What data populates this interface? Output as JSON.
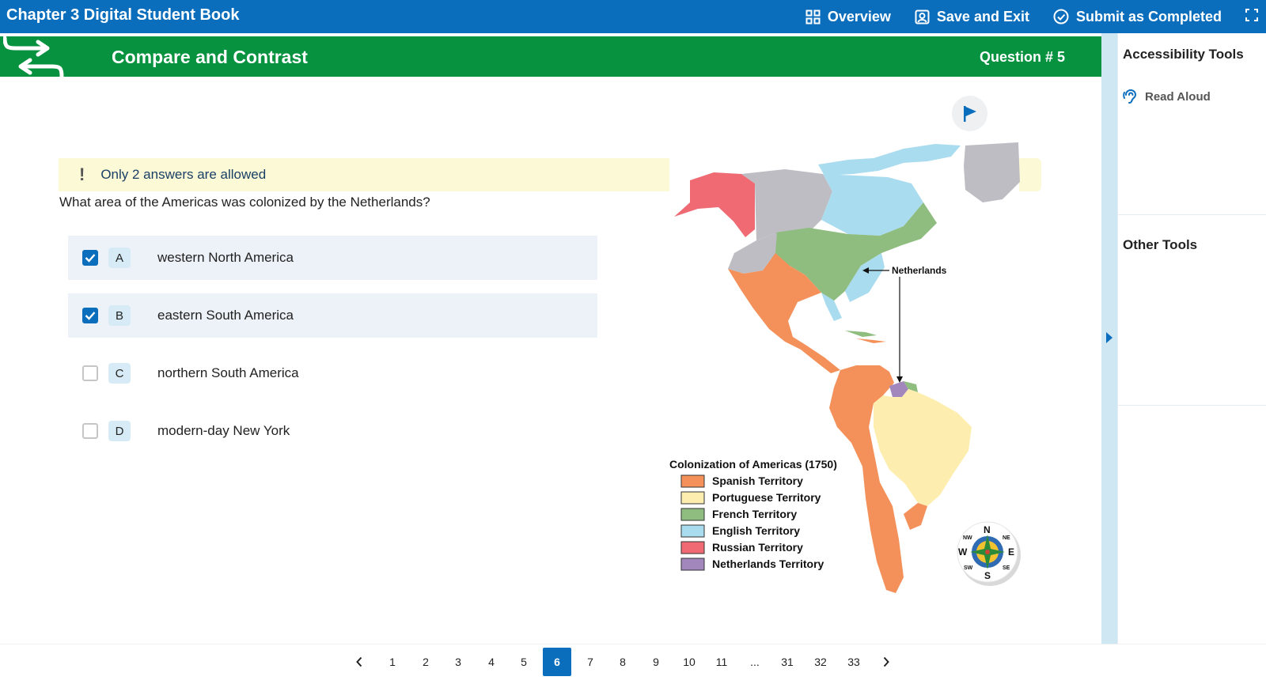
{
  "app": {
    "title": "Chapter 3 Digital Student Book",
    "actions": {
      "overview": "Overview",
      "save_exit": "Save and Exit",
      "submit": "Submit as Completed"
    }
  },
  "header": {
    "title": "Compare and Contrast",
    "question_number": "Question # 5"
  },
  "notice": {
    "icon": "!",
    "text": "Only 2 answers are allowed"
  },
  "question": {
    "text": "What area of the Americas was colonized by the Netherlands?",
    "options": [
      {
        "letter": "A",
        "text": "western North America",
        "checked": true
      },
      {
        "letter": "B",
        "text": "eastern South America",
        "checked": true
      },
      {
        "letter": "C",
        "text": "northern South America",
        "checked": false
      },
      {
        "letter": "D",
        "text": "modern-day New York",
        "checked": false
      }
    ]
  },
  "map": {
    "callout": "Netherlands",
    "legend_title": "Colonization of Americas (1750)",
    "legend": [
      {
        "label": "Spanish Territory",
        "color": "#f4915a"
      },
      {
        "label": "Portuguese Territory",
        "color": "#fdeeb0"
      },
      {
        "label": "French Territory",
        "color": "#8fbd80"
      },
      {
        "label": "English Territory",
        "color": "#a9dcee"
      },
      {
        "label": "Russian Territory",
        "color": "#ef6a73"
      },
      {
        "label": "Netherlands Territory",
        "color": "#a287bd"
      }
    ],
    "unclaimed_color": "#bdbdc3",
    "compass": {
      "n": "N",
      "s": "S",
      "e": "E",
      "w": "W",
      "ne": "NE",
      "nw": "NW",
      "se": "SE",
      "sw": "SW"
    }
  },
  "side_panel": {
    "accessibility_title": "Accessibility Tools",
    "read_aloud": "Read Aloud",
    "other_title": "Other Tools"
  },
  "pagination": {
    "pages": [
      "1",
      "2",
      "3",
      "4",
      "5",
      "6",
      "7",
      "8",
      "9",
      "10",
      "11",
      "...",
      "31",
      "32",
      "33"
    ],
    "current": "6"
  },
  "colors": {
    "brand_blue": "#0a6ebd",
    "header_green": "#07923f",
    "notice_bg": "#fcf9d6",
    "selected_bg": "#edf2f8"
  }
}
